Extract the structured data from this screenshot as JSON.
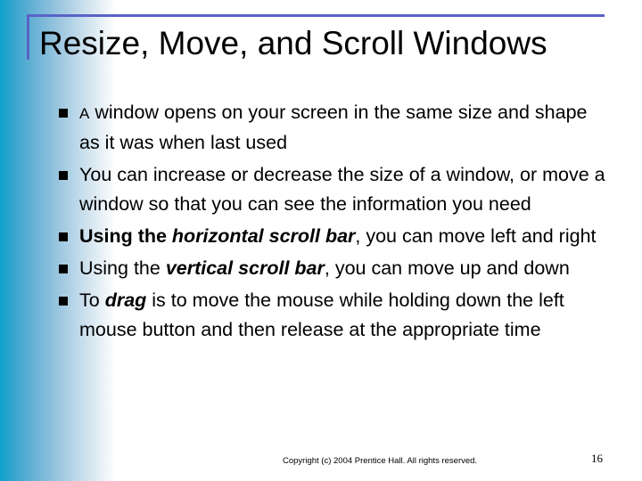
{
  "slide": {
    "title": "Resize, Move, and Scroll Windows",
    "colors": {
      "title_frame": "#5a63c8",
      "side_gradient_start": "#0ea0cc",
      "bullet": "#000000"
    },
    "bullets": [
      {
        "first_letter": "A",
        "text": " window opens on your screen in the same size and shape as it was when last used"
      },
      {
        "text": "You can increase or decrease the size of a window, or move a window so that you can see the information you need"
      },
      {
        "lead_bold": "Using the ",
        "term": "horizontal scroll bar",
        "rest": ", you can move left and right"
      },
      {
        "lead": "Using the ",
        "term": "vertical scroll bar",
        "rest": ", you can move up and down"
      },
      {
        "lead": "To ",
        "term": "drag",
        "rest": " is to move the mouse while holding down the left mouse button and then release at the appropriate time"
      }
    ],
    "footer": {
      "copyright": "Copyright (c) 2004 Prentice Hall. All rights reserved.",
      "page_number": "16"
    }
  }
}
